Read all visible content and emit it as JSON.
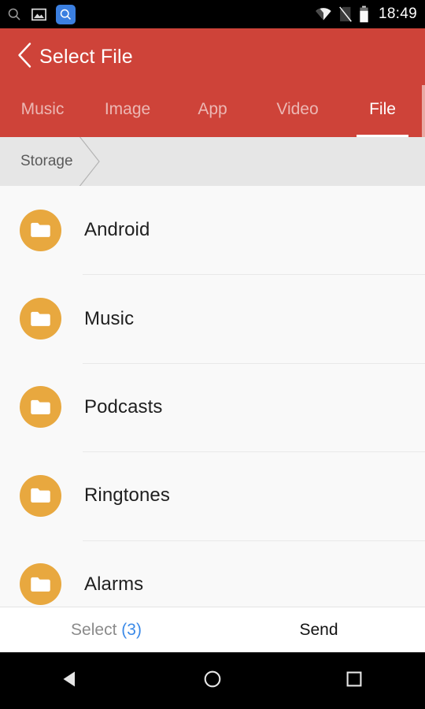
{
  "status_bar": {
    "time": "18:49",
    "left_icons": [
      {
        "name": "search-icon",
        "glyph": "search-outline"
      },
      {
        "name": "photo-icon",
        "glyph": "image"
      },
      {
        "name": "search-app-badge-icon",
        "glyph": "search-filled",
        "color": "#3b7fe0"
      }
    ],
    "right_icons": [
      {
        "name": "wifi-icon",
        "glyph": "wifi"
      },
      {
        "name": "no-sim-icon",
        "glyph": "sim-crossed"
      },
      {
        "name": "battery-icon",
        "glyph": "battery"
      }
    ]
  },
  "app_bar": {
    "back_label": "back",
    "title": "Select File",
    "background": "#ce4339"
  },
  "tabs": [
    {
      "label": "Music",
      "active": false
    },
    {
      "label": "Image",
      "active": false
    },
    {
      "label": "App",
      "active": false
    },
    {
      "label": "Video",
      "active": false
    },
    {
      "label": "File",
      "active": true
    }
  ],
  "breadcrumb": {
    "items": [
      "Storage"
    ]
  },
  "file_list": [
    {
      "name": "Android",
      "type": "folder"
    },
    {
      "name": "Music",
      "type": "folder"
    },
    {
      "name": "Podcasts",
      "type": "folder"
    },
    {
      "name": "Ringtones",
      "type": "folder"
    },
    {
      "name": "Alarms",
      "type": "folder"
    }
  ],
  "bottom_bar": {
    "select_label": "Select",
    "select_count": "(3)",
    "send_label": "Send",
    "count_color": "#3b8ae8"
  },
  "nav_bar": {
    "back": "back",
    "home": "home",
    "recents": "recents"
  },
  "colors": {
    "accent_red": "#ce4339",
    "folder_orange": "#e8a83f",
    "list_background": "#f9f9f9",
    "breadcrumb_background": "#e6e6e6"
  }
}
